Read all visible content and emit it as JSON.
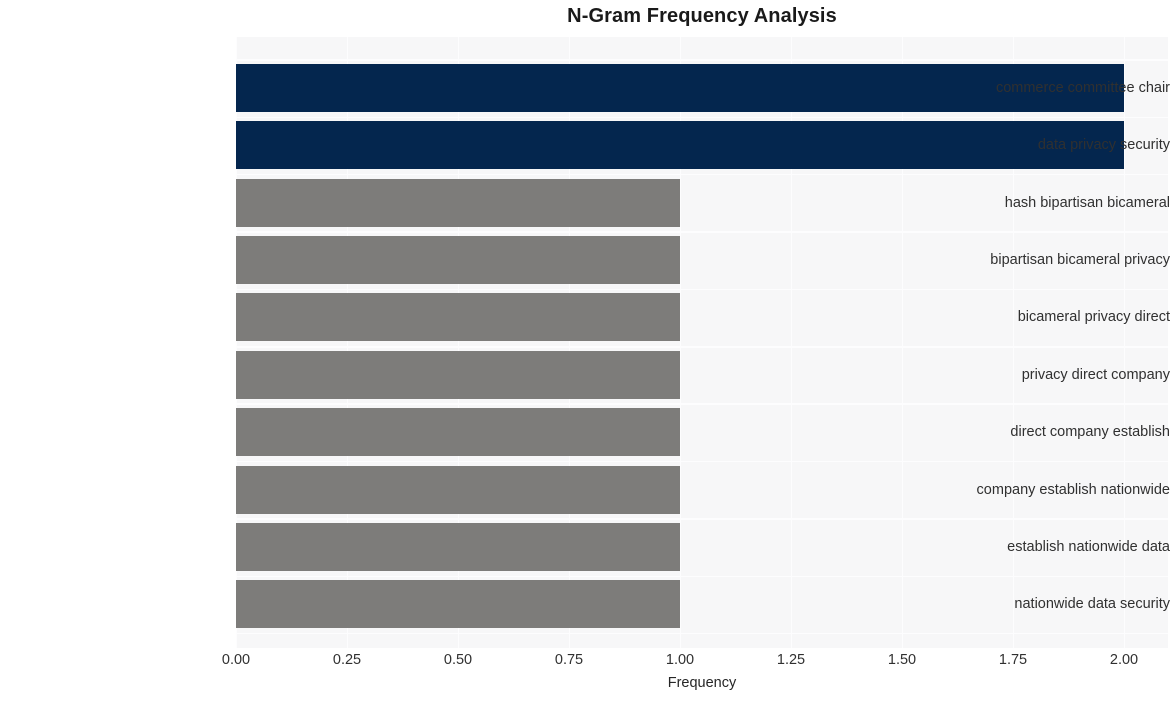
{
  "chart_data": {
    "type": "bar",
    "orientation": "horizontal",
    "title": "N-Gram Frequency Analysis",
    "xlabel": "Frequency",
    "ylabel": "",
    "categories": [
      "commerce committee chair",
      "data privacy security",
      "hash bipartisan bicameral",
      "bipartisan bicameral privacy",
      "bicameral privacy direct",
      "privacy direct company",
      "direct company establish",
      "company establish nationwide",
      "establish nationwide data",
      "nationwide data security"
    ],
    "values": [
      2,
      2,
      1,
      1,
      1,
      1,
      1,
      1,
      1,
      1
    ],
    "bar_colors": [
      "#04264e",
      "#04264e",
      "#7d7c7a",
      "#7d7c7a",
      "#7d7c7a",
      "#7d7c7a",
      "#7d7c7a",
      "#7d7c7a",
      "#7d7c7a",
      "#7d7c7a"
    ],
    "xlim": [
      0,
      2
    ],
    "xticks": [
      0,
      0.25,
      0.5,
      0.75,
      1,
      1.25,
      1.5,
      1.75,
      2
    ],
    "xtick_labels": [
      "0.00",
      "0.25",
      "0.50",
      "0.75",
      "1.00",
      "1.25",
      "1.50",
      "1.75",
      "2.00"
    ],
    "grid": true,
    "legend": null,
    "colors": {
      "highlight": "#04264e",
      "default": "#7d7c7a",
      "plot_background": "#f7f7f8",
      "grid": "#fdfdfe",
      "figure_background": "#ffffff",
      "text": "#303030",
      "title_text": "#1a1a1a"
    }
  }
}
